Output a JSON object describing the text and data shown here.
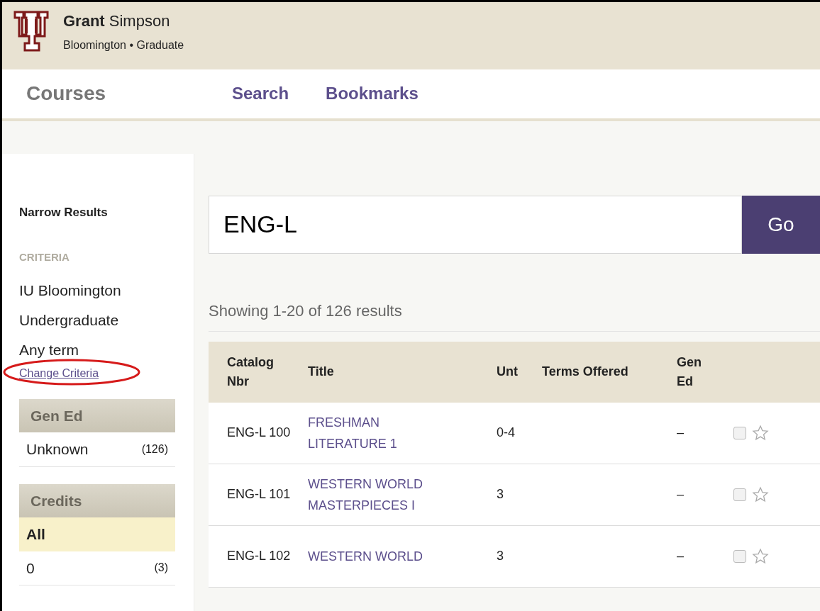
{
  "header": {
    "user_first": "Grant",
    "user_last": "Simpson",
    "subtitle": "Bloomington • Graduate"
  },
  "nav": {
    "title": "Courses",
    "links": [
      {
        "label": "Search"
      },
      {
        "label": "Bookmarks"
      }
    ]
  },
  "sidebar": {
    "title": "Narrow Results",
    "criteria_label": "CRITERIA",
    "criteria": [
      "IU Bloomington",
      "Undergraduate",
      "Any term"
    ],
    "change_link": "Change Criteria",
    "facets": [
      {
        "title": "Gen Ed",
        "items": [
          {
            "label": "Unknown",
            "count": "(126)",
            "selected": false
          }
        ]
      },
      {
        "title": "Credits",
        "items": [
          {
            "label": "All",
            "selected": true
          },
          {
            "label": "0",
            "count": "(3)",
            "selected": false
          }
        ]
      }
    ]
  },
  "search": {
    "value": "ENG-L",
    "button": "Go"
  },
  "results_summary": "Showing 1-20 of 126 results",
  "table": {
    "columns": [
      "Catalog Nbr",
      "Title",
      "Unt",
      "Terms Offered",
      "Gen Ed"
    ],
    "rows": [
      {
        "catalog": "ENG-L 100",
        "title": "FRESHMAN LITERATURE 1",
        "units": "0-4",
        "gen_ed": "–",
        "checked": false,
        "bookmarked": false
      },
      {
        "catalog": "ENG-L 101",
        "title": "WESTERN WORLD MASTERPIECES I",
        "units": "3",
        "gen_ed": "–",
        "checked": false,
        "bookmarked": false
      },
      {
        "catalog": "ENG-L 102",
        "title": "WESTERN WORLD",
        "units": "3",
        "gen_ed": "–",
        "checked": false,
        "bookmarked": false
      }
    ]
  }
}
